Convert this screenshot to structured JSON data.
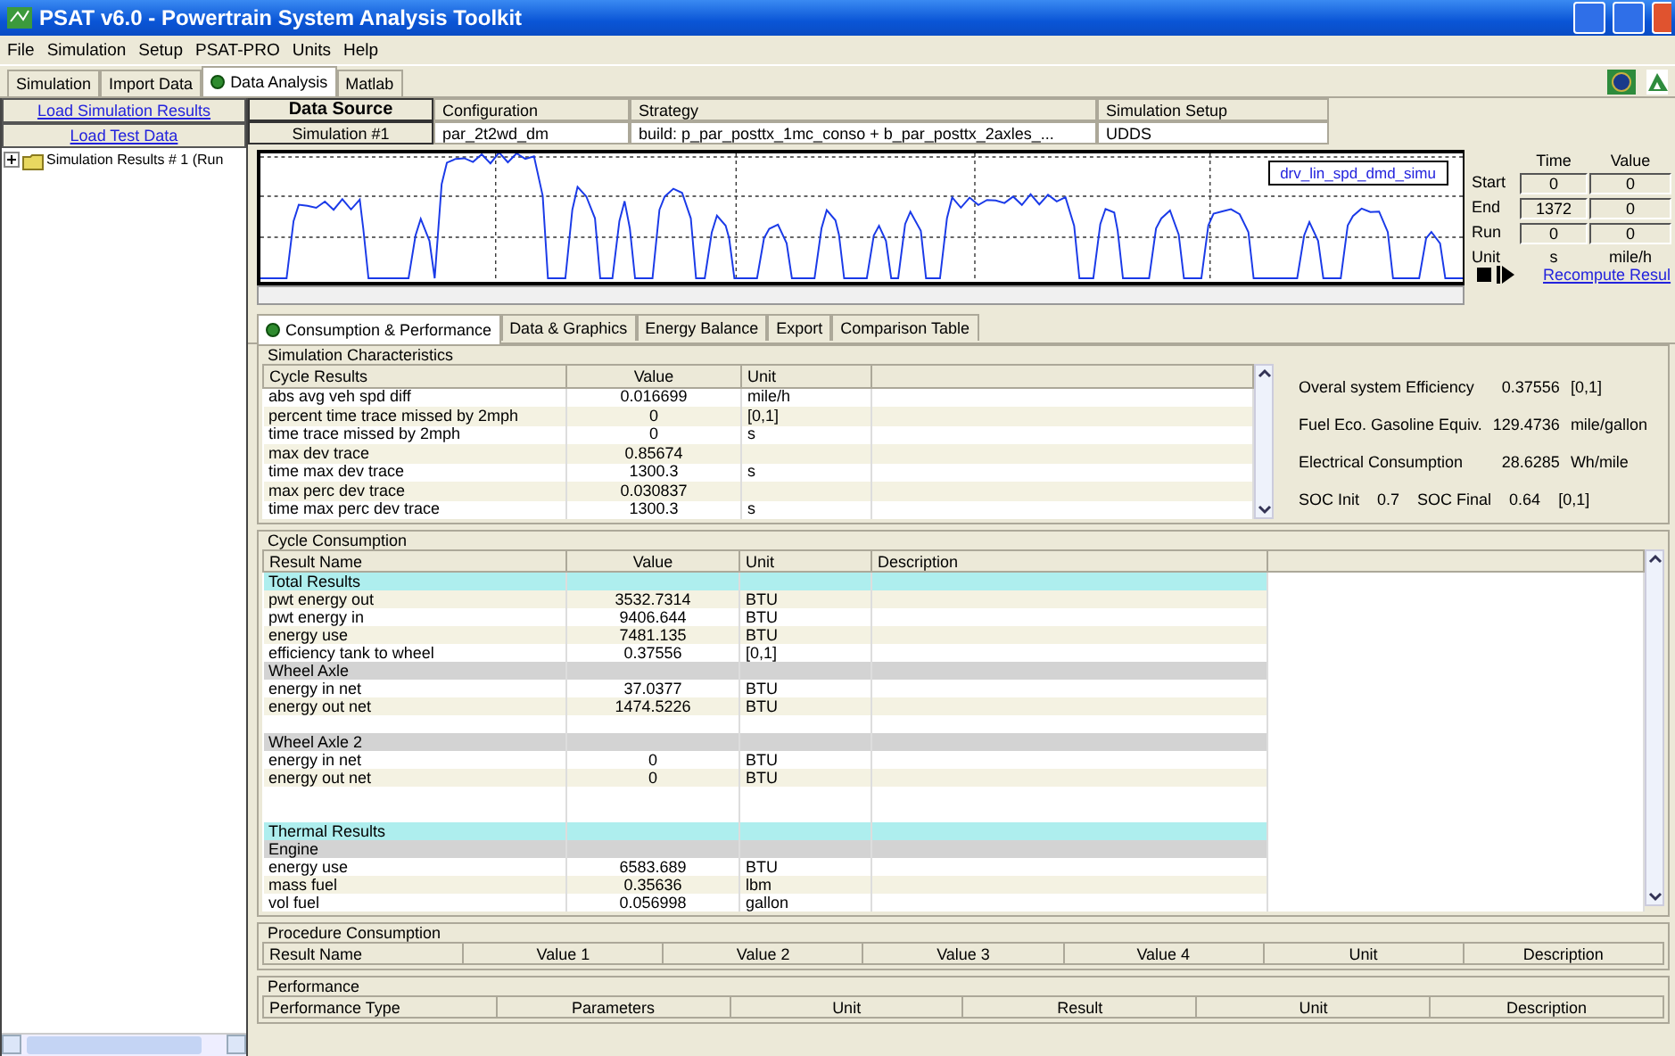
{
  "window": {
    "title": "PSAT v6.0 - Powertrain System Analysis Toolkit"
  },
  "menu": [
    "File",
    "Simulation",
    "Setup",
    "PSAT-PRO",
    "Units",
    "Help"
  ],
  "tabs": [
    {
      "label": "Simulation",
      "selected": false
    },
    {
      "label": "Import Data",
      "selected": false
    },
    {
      "label": "Data Analysis",
      "selected": true
    },
    {
      "label": "Matlab",
      "selected": false
    }
  ],
  "sidebar": {
    "links": [
      "Load Simulation Results",
      "Load Test Data"
    ],
    "tree": [
      {
        "label": "Simulation Results # 1 (Run",
        "expanded": false
      }
    ]
  },
  "data_source": {
    "label": "Data Source",
    "value": "Simulation #1",
    "columns": [
      {
        "header": "Configuration",
        "value": "par_2t2wd_dm"
      },
      {
        "header": "Strategy",
        "value": "build: p_par_posttx_1mc_conso + b_par_posttx_2axles_..."
      },
      {
        "header": "Simulation Setup",
        "value": "UDDS"
      }
    ]
  },
  "trace": {
    "legend": "drv_lin_spd_dmd_simu"
  },
  "time_table": {
    "headers": [
      "Time",
      "Value"
    ],
    "rows": [
      {
        "label": "Start",
        "time": "0",
        "value": "0"
      },
      {
        "label": "End",
        "time": "1372",
        "value": "0"
      },
      {
        "label": "Run",
        "time": "0",
        "value": "0"
      }
    ],
    "unit": {
      "label": "Unit",
      "time": "s",
      "value": "mile/h"
    }
  },
  "recompute_link": "Recompute Resul",
  "result_tabs": [
    {
      "label": "Consumption & Performance",
      "selected": true
    },
    {
      "label": "Data & Graphics",
      "selected": false
    },
    {
      "label": "Energy Balance",
      "selected": false
    },
    {
      "label": "Export",
      "selected": false
    },
    {
      "label": "Comparison Table",
      "selected": false
    }
  ],
  "simulation_characteristics": {
    "title": "Simulation Characteristics",
    "columns": [
      "Cycle Results",
      "Value",
      "Unit"
    ],
    "rows": [
      [
        "abs avg veh spd diff",
        "0.016699",
        "mile/h"
      ],
      [
        "percent time trace missed by 2mph",
        "0",
        "[0,1]"
      ],
      [
        "time trace missed by 2mph",
        "0",
        "s"
      ],
      [
        "max dev trace",
        "0.85674",
        ""
      ],
      [
        "time max dev trace",
        "1300.3",
        "s"
      ],
      [
        "max perc dev trace",
        "0.030837",
        ""
      ],
      [
        "time max perc dev trace",
        "1300.3",
        "s"
      ]
    ]
  },
  "summary": [
    {
      "label": "Overal system Efficiency",
      "value": "0.37556",
      "unit": "[0,1]"
    },
    {
      "label": "Fuel Eco. Gasoline Equiv.",
      "value": "129.4736",
      "unit": "mile/gallon"
    },
    {
      "label": "Electrical Consumption",
      "value": "28.6285",
      "unit": "Wh/mile"
    }
  ],
  "soc": {
    "init_label": "SOC Init",
    "init": "0.7",
    "final_label": "SOC Final",
    "final": "0.64",
    "unit": "[0,1]"
  },
  "cycle_consumption": {
    "title": "Cycle Consumption",
    "columns": [
      "Result Name",
      "Value",
      "Unit",
      "Description"
    ],
    "rows": [
      {
        "kind": "section",
        "name": "Total Results"
      },
      {
        "kind": "data",
        "name": "pwt energy out",
        "value": "3532.7314",
        "unit": "BTU"
      },
      {
        "kind": "data",
        "name": "pwt energy in",
        "value": "9406.644",
        "unit": "BTU"
      },
      {
        "kind": "data",
        "name": "energy use",
        "value": "7481.135",
        "unit": "BTU"
      },
      {
        "kind": "data",
        "name": "efficiency tank to wheel",
        "value": "0.37556",
        "unit": "[0,1]"
      },
      {
        "kind": "group",
        "name": "Wheel Axle"
      },
      {
        "kind": "data",
        "name": "energy in net",
        "value": "37.0377",
        "unit": "BTU"
      },
      {
        "kind": "data",
        "name": "energy out net",
        "value": "1474.5226",
        "unit": "BTU"
      },
      {
        "kind": "blank"
      },
      {
        "kind": "group",
        "name": "Wheel Axle 2"
      },
      {
        "kind": "data",
        "name": "energy in net",
        "value": "0",
        "unit": "BTU"
      },
      {
        "kind": "data",
        "name": "energy out net",
        "value": "0",
        "unit": "BTU"
      },
      {
        "kind": "blank"
      },
      {
        "kind": "blank"
      },
      {
        "kind": "section",
        "name": "Thermal Results"
      },
      {
        "kind": "group",
        "name": "Engine"
      },
      {
        "kind": "data",
        "name": "energy use",
        "value": "6583.689",
        "unit": "BTU"
      },
      {
        "kind": "data",
        "name": "mass fuel",
        "value": "0.35636",
        "unit": "lbm"
      },
      {
        "kind": "data",
        "name": "vol fuel",
        "value": "0.056998",
        "unit": "gallon"
      }
    ]
  },
  "procedure_consumption": {
    "title": "Procedure Consumption",
    "columns": [
      "Result Name",
      "Value 1",
      "Value 2",
      "Value 3",
      "Value 4",
      "Unit",
      "Description"
    ]
  },
  "performance": {
    "title": "Performance",
    "columns": [
      "Performance Type",
      "Parameters",
      "Unit",
      "Result",
      "Unit",
      "Description"
    ]
  }
}
